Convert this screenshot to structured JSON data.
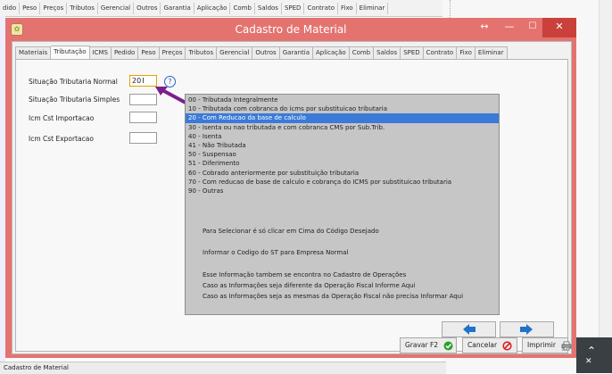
{
  "background": {
    "tabs": [
      "dido",
      "Peso",
      "Preços",
      "Tributos",
      "Gerencial",
      "Outros",
      "Garantia",
      "Aplicação",
      "Comb",
      "Saldos",
      "SPED",
      "Contrato",
      "Fixo",
      "Eliminar"
    ],
    "status_text": "Cadastro de Material"
  },
  "window": {
    "title": "Cadastro de Material",
    "resize_glyph": "↔",
    "minimize_glyph": "—",
    "maximize_glyph": "☐",
    "close_glyph": "✕"
  },
  "tabs": [
    "Materiais",
    "Tributação",
    "ICMS",
    "Pedido",
    "Peso",
    "Preços",
    "Tributos",
    "Gerencial",
    "Outros",
    "Garantia",
    "Aplicação",
    "Comb",
    "Saldos",
    "SPED",
    "Contrato",
    "Fixo",
    "Eliminar"
  ],
  "active_tab": "Tributação",
  "fields": {
    "sit_normal": {
      "label": "Situação Tributaria Normal",
      "value": "20"
    },
    "sit_simples": {
      "label": "Situação Tributaria Simples",
      "value": ""
    },
    "cst_importacao": {
      "label": "Icm Cst Importacao",
      "value": ""
    },
    "cst_exportacao": {
      "label": "Icm Cst Exportacao",
      "value": ""
    },
    "help_glyph": "?"
  },
  "st_list": [
    "00 - Tributada Integralmente",
    "10 - Tributada com cobranca do icms por substituicao tributaria",
    "20 - Com Reducao da base de calculo",
    "30 - Isenta ou nao tributada e com cobranca CMS por Sub.Trib.",
    "40 - Isenta",
    "41 - Não Tributada",
    "50 - Suspensao",
    "51 - Diferimento",
    "60 - Cobrado anteriormente por substituição tributaria",
    "70 - Com reducao de base de calculo e cobrança do ICMS por substituicao tributaria",
    "90 - Outras"
  ],
  "st_selected_index": 2,
  "notes": {
    "n1": "Para Selecionar é só clicar em Cima do Código Desejado",
    "n2": "Informar o Codigo do ST para Empresa Normal",
    "n3": "Esse Informação tambem se encontra no Cadastro de Operações",
    "n4": "Caso as Informações seja diferente da Operação Fiscal Informe Aqui",
    "n5": "Caso as Informações seja as mesmas da Operação Fiscal não precisa Informar Aqui"
  },
  "buttons": {
    "gravar": "Gravar F2",
    "cancelar": "Cancelar",
    "imprimir": "Imprimir"
  },
  "colors": {
    "title_bar": "#e4736f",
    "selected_row": "#3b7ad8",
    "arrow_blue": "#1f73c8",
    "annotation_arrow": "#7b1f8c"
  }
}
